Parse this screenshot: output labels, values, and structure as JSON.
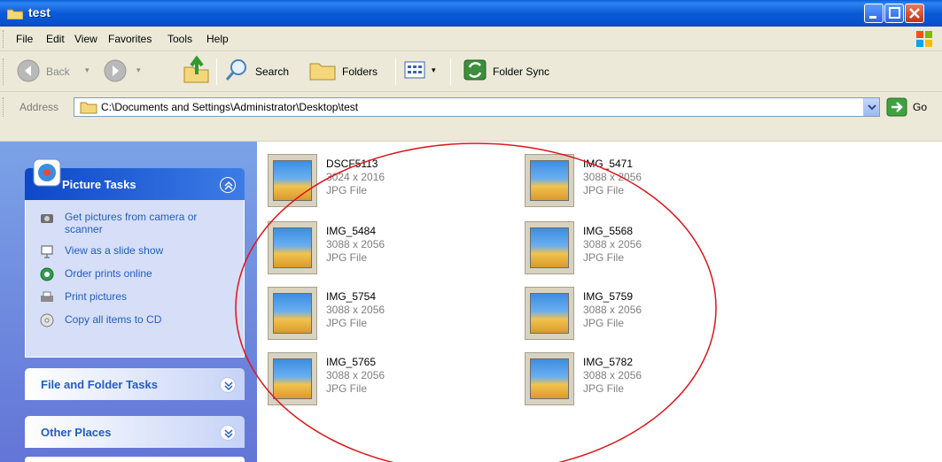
{
  "window": {
    "title": "test"
  },
  "menu": [
    "File",
    "Edit",
    "View",
    "Favorites",
    "Tools",
    "Help"
  ],
  "toolbar": {
    "back_label": "Back",
    "search_label": "Search",
    "folders_label": "Folders",
    "sync_label": "Folder Sync"
  },
  "address": {
    "label": "Address",
    "path": "C:\\Documents and Settings\\Administrator\\Desktop\\test",
    "go_label": "Go"
  },
  "left_pane": {
    "picture_tasks": {
      "title": "Picture Tasks",
      "items": [
        {
          "label": "Get pictures from camera or scanner",
          "icon": "camera-icon"
        },
        {
          "label": "View as a slide show",
          "icon": "slideshow-icon"
        },
        {
          "label": "Order prints online",
          "icon": "globe-icon"
        },
        {
          "label": "Print pictures",
          "icon": "print-icon"
        },
        {
          "label": "Copy all items to CD",
          "icon": "cd-icon"
        }
      ]
    },
    "file_folder_tasks": {
      "title": "File and Folder Tasks"
    },
    "other_places": {
      "title": "Other Places"
    }
  },
  "files": [
    {
      "name": "DSCF5113",
      "dims": "3024 x 2016",
      "type": "JPG File"
    },
    {
      "name": "IMG_5471",
      "dims": "3088 x 2056",
      "type": "JPG File"
    },
    {
      "name": "IMG_5484",
      "dims": "3088 x 2056",
      "type": "JPG File"
    },
    {
      "name": "IMG_5568",
      "dims": "3088 x 2056",
      "type": "JPG File"
    },
    {
      "name": "IMG_5754",
      "dims": "3088 x 2056",
      "type": "JPG File"
    },
    {
      "name": "IMG_5759",
      "dims": "3088 x 2056",
      "type": "JPG File"
    },
    {
      "name": "IMG_5765",
      "dims": "3088 x 2056",
      "type": "JPG File"
    },
    {
      "name": "IMG_5782",
      "dims": "3088 x 2056",
      "type": "JPG File"
    }
  ],
  "colors": {
    "titlebar": "#0a5fd8",
    "task_link": "#215dc6",
    "annotation": "#e0141a"
  }
}
